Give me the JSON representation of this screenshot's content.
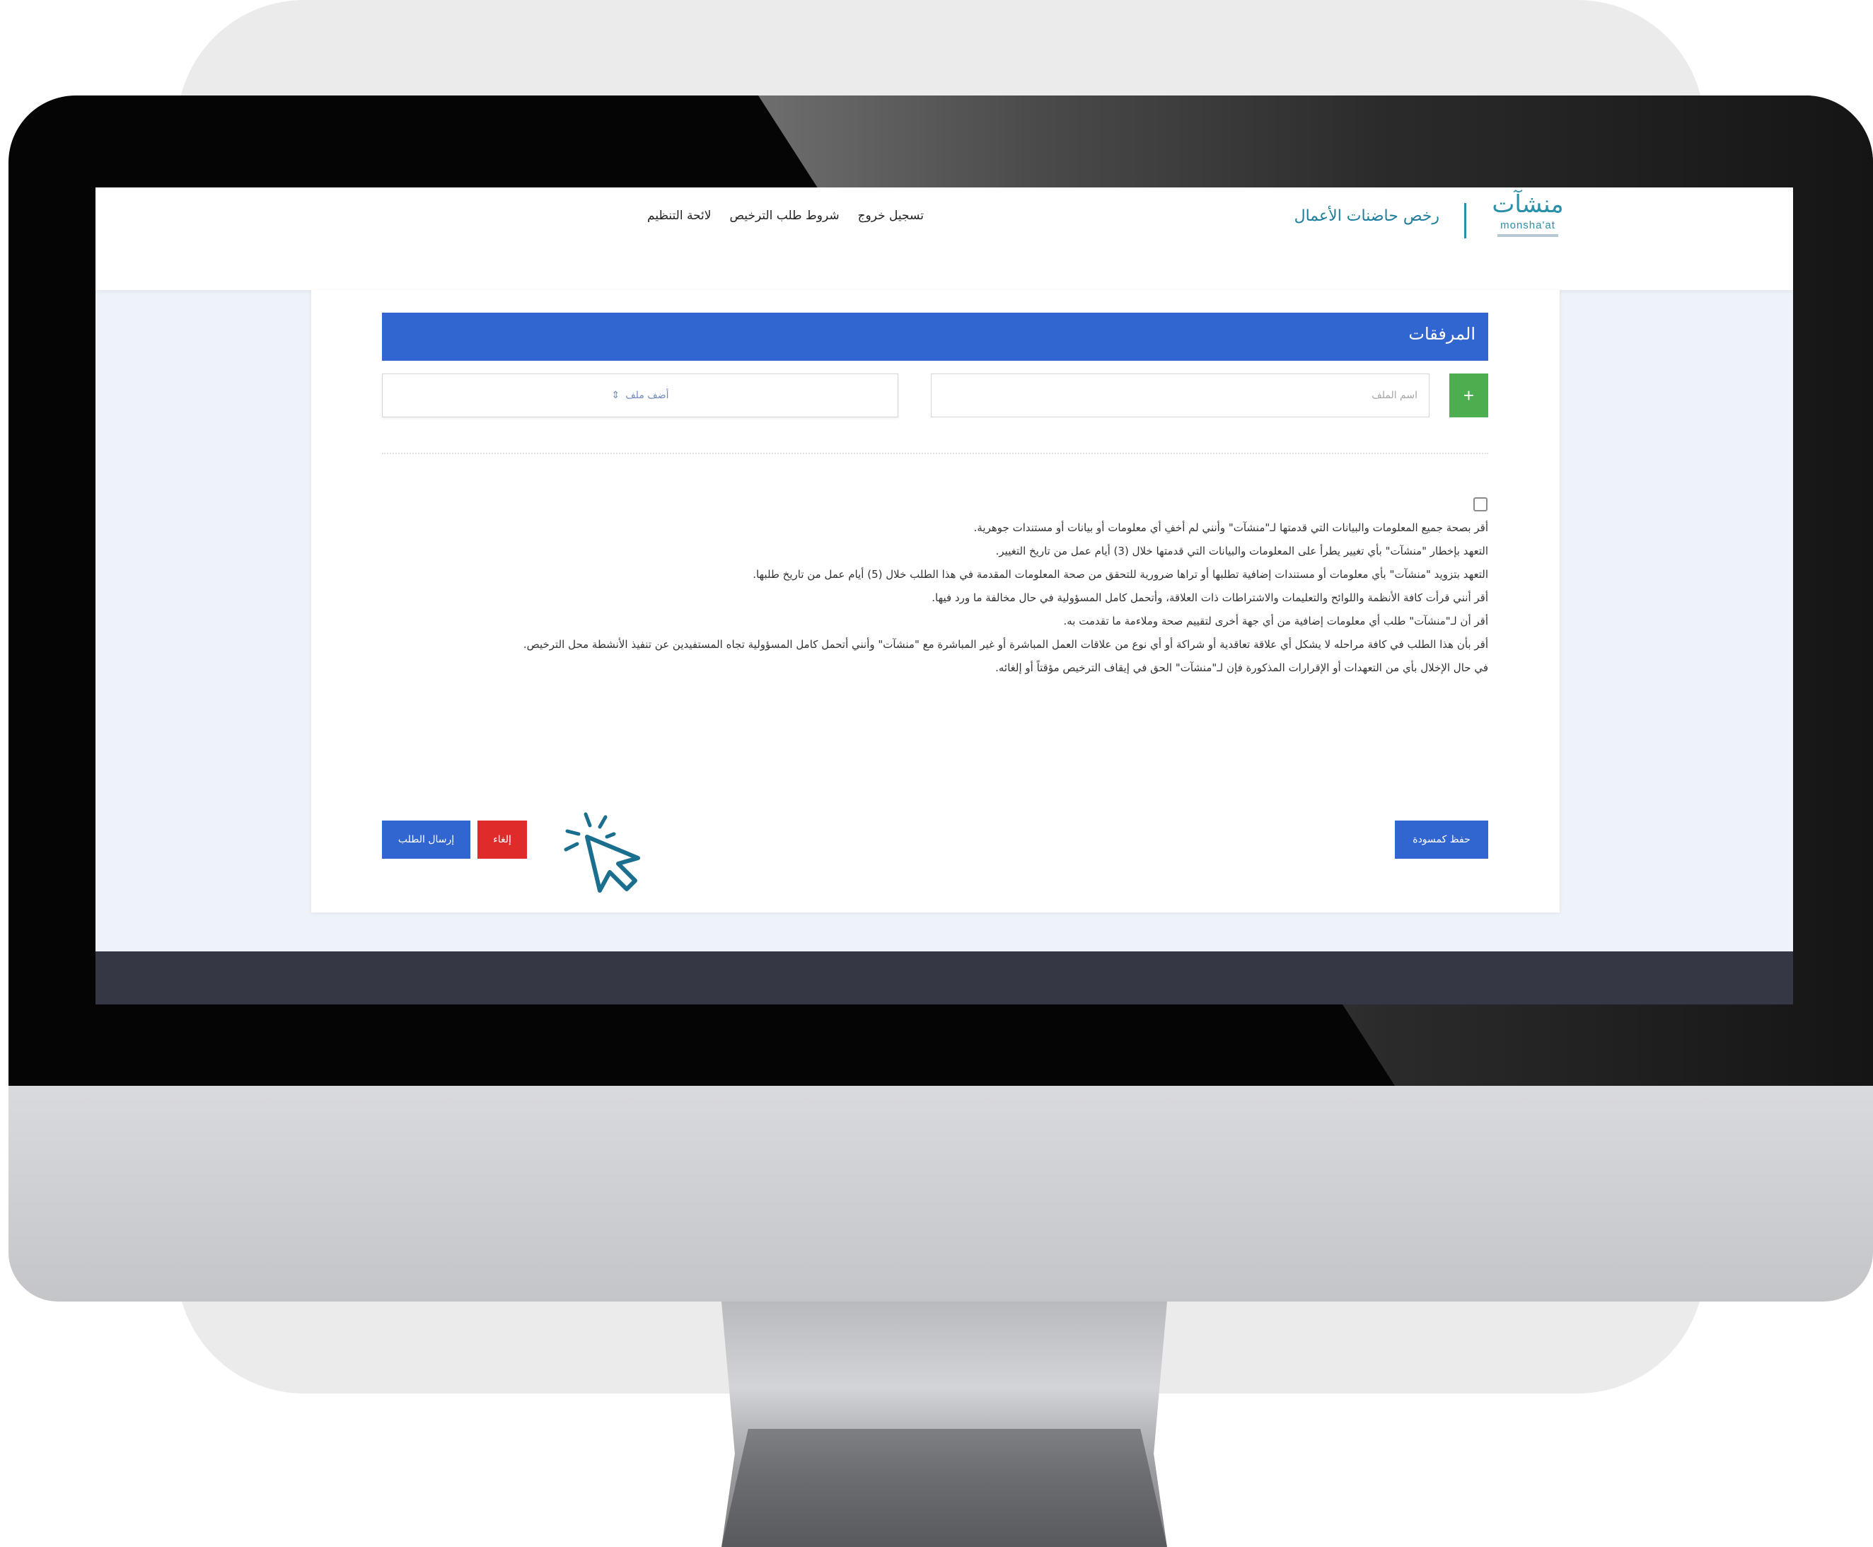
{
  "header": {
    "logo_ar": "منشآت",
    "logo_en": "monsha'at",
    "site_title": "رخص حاضنات الأعمال",
    "nav": [
      {
        "label": "لائحة التنظيم"
      },
      {
        "label": "شروط طلب الترخيص"
      },
      {
        "label": "تسجيل خروج"
      }
    ]
  },
  "attachments": {
    "section_title": "المرفقات",
    "add_button": "+",
    "filename_placeholder": "اسم الملف",
    "upload_label": "أضف ملف",
    "upload_icon": "⇕"
  },
  "terms": [
    "أقر بصحة جميع المعلومات والبيانات التي قدمتها لـ\"منشآت\" وأنني لم أخفِ أي معلومات أو بيانات أو مستندات جوهرية.",
    "التعهد بإخطار \"منشآت\" بأي تغيير يطرأ على المعلومات والبيانات التي قدمتها خلال (3) أيام عمل من تاريخ التغيير.",
    "التعهد بتزويد \"منشآت\" بأي معلومات أو مستندات إضافية تطلبها أو تراها ضرورية للتحقق من صحة المعلومات المقدمة في هذا الطلب خلال (5) أيام عمل من تاريخ طلبها.",
    "أقر أنني قرأت كافة الأنظمة واللوائح والتعليمات والاشتراطات ذات العلاقة، وأتحمل كامل المسؤولية في حال مخالفة ما ورد فيها.",
    "أقر أن لـ\"منشآت\" طلب أي معلومات إضافية من أي جهة أخرى لتقييم صحة وملاءمة ما تقدمت به.",
    "أقر بأن هذا الطلب في كافة مراحله لا يشكل أي علاقة تعاقدية أو شراكة أو أي نوع من علاقات العمل المباشرة أو غير المباشرة مع \"منشآت\" وأنني أتحمل كامل المسؤولية تجاه المستفيدين عن تنفيذ الأنشطة محل الترخيص.",
    "في حال الإخلال بأي من التعهدات أو الإقرارات المذكورة فإن لـ\"منشآت\" الحق في إيقاف الترخيص مؤقتاً أو إلغائه."
  ],
  "actions": {
    "save_draft": "حفظ كمسودة",
    "submit": "إرسال الطلب",
    "cancel": "إلغاء"
  },
  "colors": {
    "primary": "#3165cf",
    "success": "#4cae4f",
    "danger": "#e02b2b",
    "brand_teal": "#2a8fa9",
    "footer": "#353745"
  }
}
